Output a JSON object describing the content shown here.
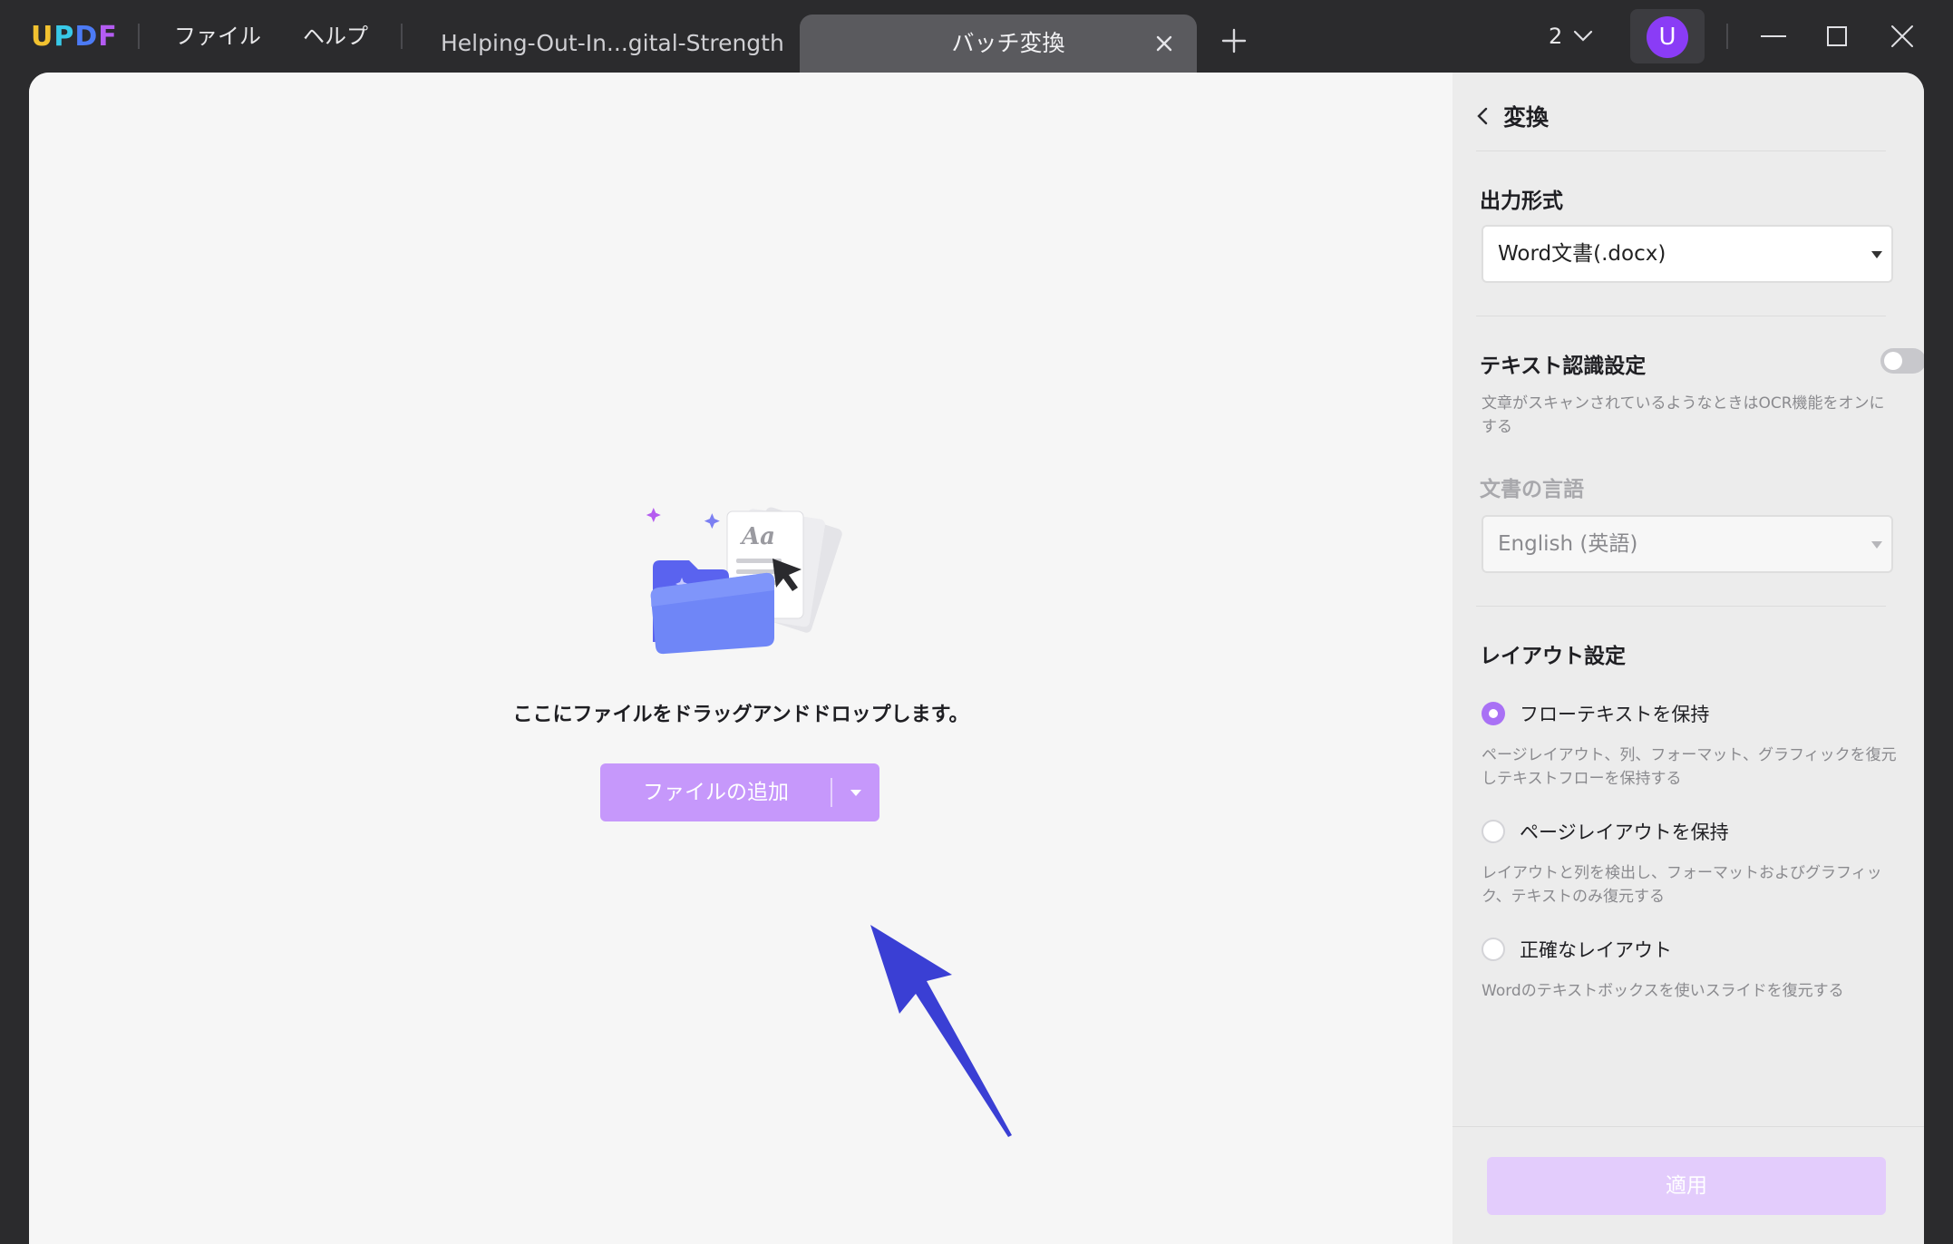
{
  "app": {
    "logo": "UPDF",
    "menu": [
      "ファイル",
      "ヘルプ"
    ],
    "tabs": {
      "inactive": "Helping-Out-In...gital-Strength",
      "active": "バッチ変換"
    },
    "page_count": "2",
    "avatar_initial": "U",
    "colors": {
      "accent": "#a971f5",
      "avatar": "#8a3cf6",
      "titlebar": "#2b2b2d"
    }
  },
  "dropzone": {
    "instruction": "ここにファイルをドラッグアンドドロップします。",
    "add_button_label": "ファイルの追加"
  },
  "panel": {
    "back_label": "変換",
    "output_format": {
      "title": "出力形式",
      "value": "Word文書(.docx)"
    },
    "ocr": {
      "title": "テキスト認識設定",
      "enabled": false,
      "description": "文章がスキャンされているようなときはOCR機能をオンにする"
    },
    "language": {
      "title": "文書の言語",
      "value": "English (英語)"
    },
    "layout": {
      "title": "レイアウト設定",
      "options": [
        {
          "label": "フローテキストを保持",
          "selected": true,
          "description": "ページレイアウト、列、フォーマット、グラフィックを復元しテキストフローを保持する"
        },
        {
          "label": "ページレイアウトを保持",
          "selected": false,
          "description": "レイアウトと列を検出し、フォーマットおよびグラフィック、テキストのみ復元する"
        },
        {
          "label": "正確なレイアウト",
          "selected": false,
          "description": "Wordのテキストボックスを使いスライドを復元する"
        }
      ]
    },
    "apply_label": "適用"
  }
}
